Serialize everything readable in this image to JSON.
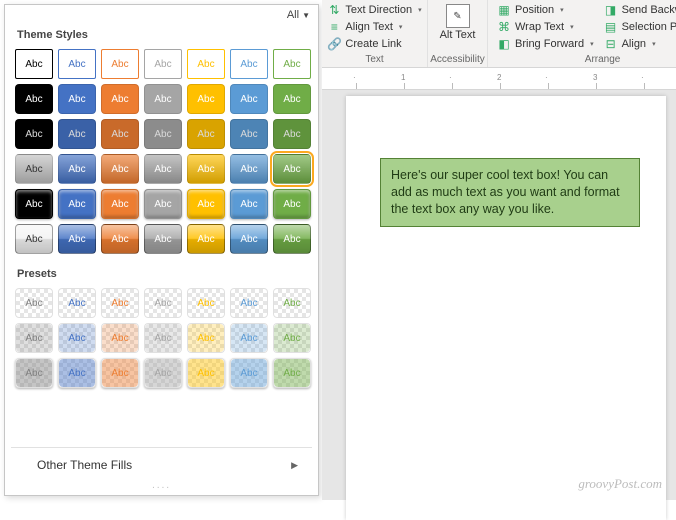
{
  "panel": {
    "all_label": "All",
    "theme_styles_title": "Theme Styles",
    "presets_title": "Presets",
    "other_fills": "Other Theme Fills",
    "swatch_label": "Abc",
    "theme_colors": [
      "#ffffff",
      "#000000",
      "#4472c4",
      "#ed7d31",
      "#a5a5a5",
      "#ffc000",
      "#5b9bd5",
      "#70ad47"
    ],
    "theme_row_styles": [
      "outline",
      "solid",
      "solid-dark",
      "gradient",
      "bevel",
      "glossy"
    ],
    "preset_rows": 3,
    "preset_text_colors": [
      "#7f7f7f",
      "#4472c4",
      "#ed7d31",
      "#a5a5a5",
      "#ffc000",
      "#5b9bd5",
      "#70ad47"
    ],
    "selected": {
      "row": 3,
      "col": 6
    }
  },
  "ribbon": {
    "text": {
      "label": "Text",
      "text_direction": "Text Direction",
      "align_text": "Align Text",
      "create_link": "Create Link"
    },
    "accessibility": {
      "label": "Accessibility",
      "alt_text": "Alt Text"
    },
    "arrange": {
      "label": "Arrange",
      "position": "Position",
      "wrap_text": "Wrap Text",
      "bring_forward": "Bring Forward",
      "send_backward": "Send Backward",
      "selection_pane": "Selection Pane",
      "align": "Align"
    }
  },
  "document": {
    "textbox_content": "Here's our super cool text box! You can add as much text as you want and format the text box any way you like."
  },
  "watermark": "groovyPost.com"
}
